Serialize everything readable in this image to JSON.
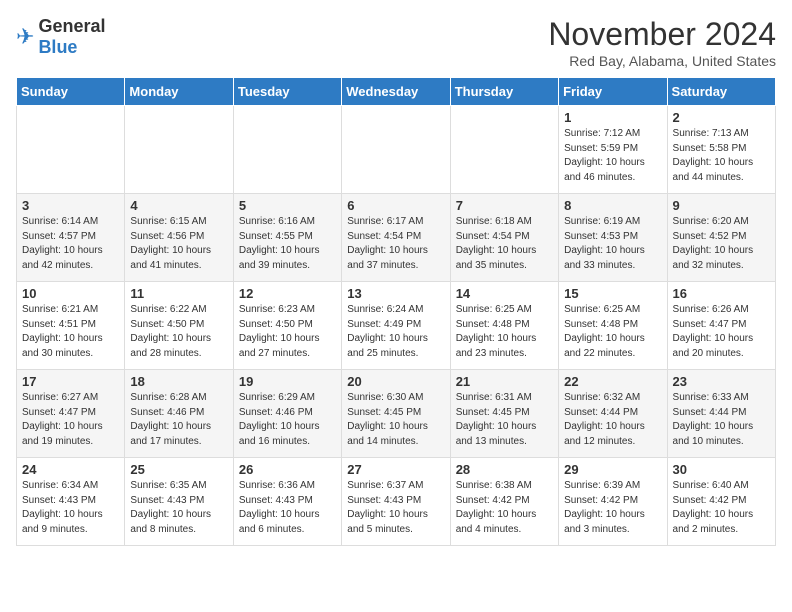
{
  "logo": {
    "general": "General",
    "blue": "Blue"
  },
  "title": "November 2024",
  "subtitle": "Red Bay, Alabama, United States",
  "days_of_week": [
    "Sunday",
    "Monday",
    "Tuesday",
    "Wednesday",
    "Thursday",
    "Friday",
    "Saturday"
  ],
  "weeks": [
    [
      {
        "day": "",
        "info": ""
      },
      {
        "day": "",
        "info": ""
      },
      {
        "day": "",
        "info": ""
      },
      {
        "day": "",
        "info": ""
      },
      {
        "day": "",
        "info": ""
      },
      {
        "day": "1",
        "info": "Sunrise: 7:12 AM\nSunset: 5:59 PM\nDaylight: 10 hours\nand 46 minutes."
      },
      {
        "day": "2",
        "info": "Sunrise: 7:13 AM\nSunset: 5:58 PM\nDaylight: 10 hours\nand 44 minutes."
      }
    ],
    [
      {
        "day": "3",
        "info": "Sunrise: 6:14 AM\nSunset: 4:57 PM\nDaylight: 10 hours\nand 42 minutes."
      },
      {
        "day": "4",
        "info": "Sunrise: 6:15 AM\nSunset: 4:56 PM\nDaylight: 10 hours\nand 41 minutes."
      },
      {
        "day": "5",
        "info": "Sunrise: 6:16 AM\nSunset: 4:55 PM\nDaylight: 10 hours\nand 39 minutes."
      },
      {
        "day": "6",
        "info": "Sunrise: 6:17 AM\nSunset: 4:54 PM\nDaylight: 10 hours\nand 37 minutes."
      },
      {
        "day": "7",
        "info": "Sunrise: 6:18 AM\nSunset: 4:54 PM\nDaylight: 10 hours\nand 35 minutes."
      },
      {
        "day": "8",
        "info": "Sunrise: 6:19 AM\nSunset: 4:53 PM\nDaylight: 10 hours\nand 33 minutes."
      },
      {
        "day": "9",
        "info": "Sunrise: 6:20 AM\nSunset: 4:52 PM\nDaylight: 10 hours\nand 32 minutes."
      }
    ],
    [
      {
        "day": "10",
        "info": "Sunrise: 6:21 AM\nSunset: 4:51 PM\nDaylight: 10 hours\nand 30 minutes."
      },
      {
        "day": "11",
        "info": "Sunrise: 6:22 AM\nSunset: 4:50 PM\nDaylight: 10 hours\nand 28 minutes."
      },
      {
        "day": "12",
        "info": "Sunrise: 6:23 AM\nSunset: 4:50 PM\nDaylight: 10 hours\nand 27 minutes."
      },
      {
        "day": "13",
        "info": "Sunrise: 6:24 AM\nSunset: 4:49 PM\nDaylight: 10 hours\nand 25 minutes."
      },
      {
        "day": "14",
        "info": "Sunrise: 6:25 AM\nSunset: 4:48 PM\nDaylight: 10 hours\nand 23 minutes."
      },
      {
        "day": "15",
        "info": "Sunrise: 6:25 AM\nSunset: 4:48 PM\nDaylight: 10 hours\nand 22 minutes."
      },
      {
        "day": "16",
        "info": "Sunrise: 6:26 AM\nSunset: 4:47 PM\nDaylight: 10 hours\nand 20 minutes."
      }
    ],
    [
      {
        "day": "17",
        "info": "Sunrise: 6:27 AM\nSunset: 4:47 PM\nDaylight: 10 hours\nand 19 minutes."
      },
      {
        "day": "18",
        "info": "Sunrise: 6:28 AM\nSunset: 4:46 PM\nDaylight: 10 hours\nand 17 minutes."
      },
      {
        "day": "19",
        "info": "Sunrise: 6:29 AM\nSunset: 4:46 PM\nDaylight: 10 hours\nand 16 minutes."
      },
      {
        "day": "20",
        "info": "Sunrise: 6:30 AM\nSunset: 4:45 PM\nDaylight: 10 hours\nand 14 minutes."
      },
      {
        "day": "21",
        "info": "Sunrise: 6:31 AM\nSunset: 4:45 PM\nDaylight: 10 hours\nand 13 minutes."
      },
      {
        "day": "22",
        "info": "Sunrise: 6:32 AM\nSunset: 4:44 PM\nDaylight: 10 hours\nand 12 minutes."
      },
      {
        "day": "23",
        "info": "Sunrise: 6:33 AM\nSunset: 4:44 PM\nDaylight: 10 hours\nand 10 minutes."
      }
    ],
    [
      {
        "day": "24",
        "info": "Sunrise: 6:34 AM\nSunset: 4:43 PM\nDaylight: 10 hours\nand 9 minutes."
      },
      {
        "day": "25",
        "info": "Sunrise: 6:35 AM\nSunset: 4:43 PM\nDaylight: 10 hours\nand 8 minutes."
      },
      {
        "day": "26",
        "info": "Sunrise: 6:36 AM\nSunset: 4:43 PM\nDaylight: 10 hours\nand 6 minutes."
      },
      {
        "day": "27",
        "info": "Sunrise: 6:37 AM\nSunset: 4:43 PM\nDaylight: 10 hours\nand 5 minutes."
      },
      {
        "day": "28",
        "info": "Sunrise: 6:38 AM\nSunset: 4:42 PM\nDaylight: 10 hours\nand 4 minutes."
      },
      {
        "day": "29",
        "info": "Sunrise: 6:39 AM\nSunset: 4:42 PM\nDaylight: 10 hours\nand 3 minutes."
      },
      {
        "day": "30",
        "info": "Sunrise: 6:40 AM\nSunset: 4:42 PM\nDaylight: 10 hours\nand 2 minutes."
      }
    ]
  ]
}
